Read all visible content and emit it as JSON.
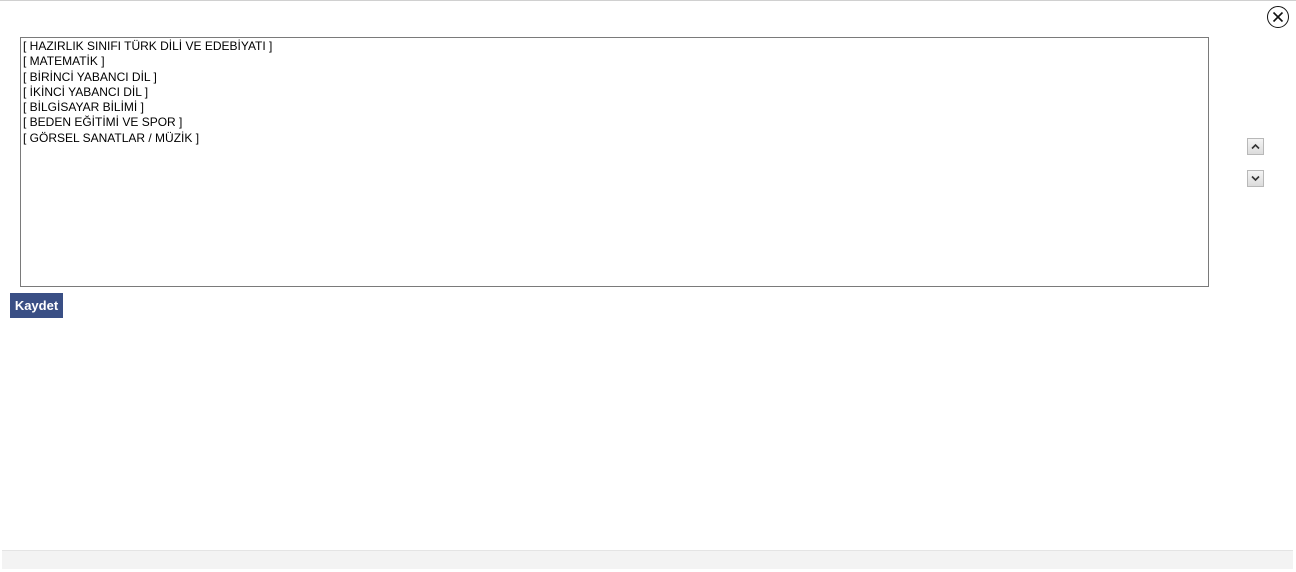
{
  "dialog": {
    "close_icon": "close-circle-icon"
  },
  "course_list": {
    "items": [
      "[ HAZIRLIK SINIFI TÜRK DİLİ VE EDEBİYATI ]",
      "[ MATEMATİK ]",
      "[ BİRİNCİ YABANCI DİL ]",
      "[ İKİNCİ YABANCI DİL ]",
      "[ BİLGİSAYAR BİLİMİ ]",
      "[ BEDEN EĞİTİMİ VE SPOR ]",
      "[ GÖRSEL SANATLAR / MÜZİK ]"
    ]
  },
  "order_controls": {
    "up_icon": "chevron-up-icon",
    "down_icon": "chevron-down-icon"
  },
  "actions": {
    "save_label": "Kaydet",
    "save_color": "#3a4f85"
  }
}
